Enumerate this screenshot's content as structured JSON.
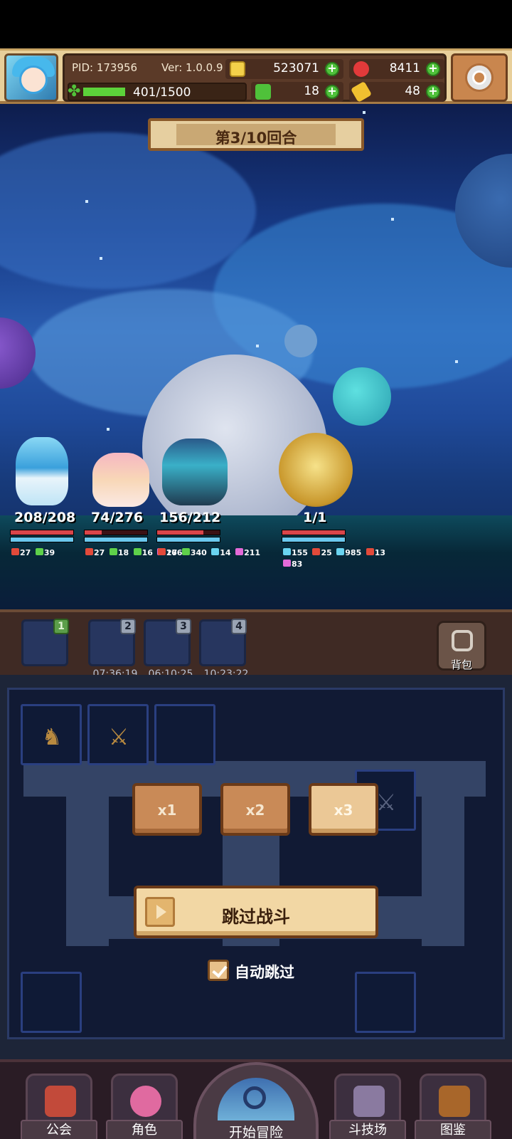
{
  "header": {
    "pid": "PID: 173956",
    "version": "Ver: 1.0.0.9",
    "gold": "523071",
    "gems": "8411",
    "clover": "18",
    "key": "48",
    "exp": "401/1500",
    "exp_progress": 0.27
  },
  "battle": {
    "round_label": "第3/10回合"
  },
  "units": [
    {
      "hp": "208/208",
      "hp_ratio": 1.0,
      "stats": [
        "27",
        "39"
      ]
    },
    {
      "hp": "74/276",
      "hp_ratio": 0.27,
      "stats": [
        "27",
        "18",
        "16",
        "166"
      ]
    },
    {
      "hp": "156/212",
      "hp_ratio": 0.74,
      "stats": [
        "27",
        "340",
        "14",
        "211"
      ]
    },
    {
      "hp": "1/1",
      "hp_ratio": 1.0,
      "stats": [
        "155",
        "25",
        "985",
        "13"
      ],
      "stats2": [
        "83"
      ]
    }
  ],
  "team": {
    "slots": [
      {
        "badge": "1",
        "timer": ""
      },
      {
        "badge": "2",
        "timer": "07:36:19"
      },
      {
        "badge": "3",
        "timer": "06:10:25"
      },
      {
        "badge": "4",
        "timer": "10:23:22"
      }
    ],
    "bag_label": "背包"
  },
  "controls": {
    "speed_x1": "x1",
    "speed_x2": "x2",
    "speed_x3": "x3",
    "skip_label": "跳过战斗",
    "auto_skip_label": "自动跳过",
    "auto_skip_checked": true
  },
  "nav": {
    "guild": "公会",
    "character": "角色",
    "adventure": "开始冒险",
    "arena": "斗技场",
    "codex": "图鉴"
  },
  "colors": {
    "hp": "#d9454a",
    "shield": "#6ac8ee",
    "accent_gold": "#e8cf9a"
  }
}
